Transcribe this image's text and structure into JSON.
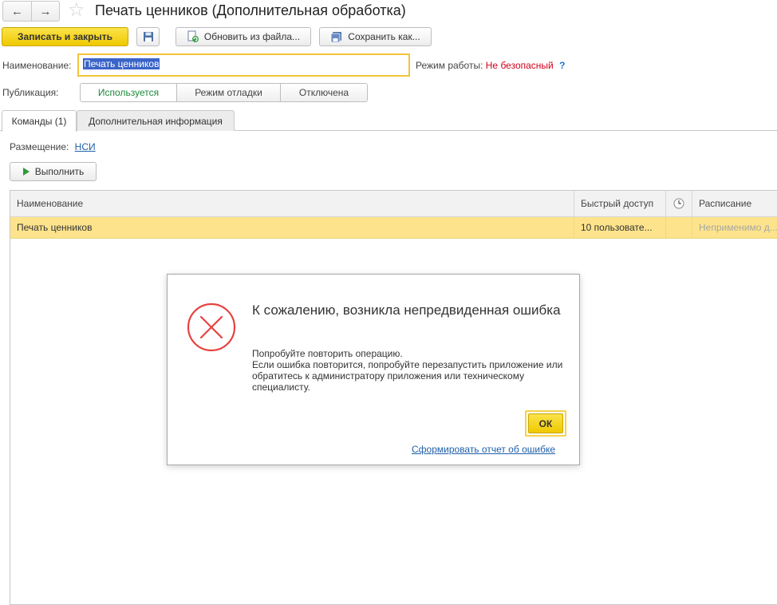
{
  "window": {
    "title": "Печать ценников (Дополнительная обработка)",
    "back_icon": "←",
    "forward_icon": "→",
    "star_icon": "☆"
  },
  "toolbar": {
    "save_close_label": "Записать и закрыть",
    "update_from_file_label": "Обновить из файла...",
    "save_as_label": "Сохранить как..."
  },
  "form": {
    "name_label": "Наименование:",
    "name_value": "Печать ценников",
    "mode_label": "Режим работы:",
    "mode_value": "Не безопасный",
    "help_label": "?",
    "publication_label": "Публикация:",
    "publication_options": [
      "Используется",
      "Режим отладки",
      "Отключена"
    ],
    "publication_selected": "Используется"
  },
  "tabs": [
    {
      "label": "Команды (1)",
      "active": true
    },
    {
      "label": "Дополнительная информация",
      "active": false
    }
  ],
  "commands": {
    "placement_label": "Размещение:",
    "placement_value": "НСИ",
    "run_label": "Выполнить",
    "columns": [
      "Наименование",
      "Быстрый доступ",
      "",
      "Расписание"
    ],
    "rows": [
      {
        "name": "Печать ценников",
        "quick_access": "10 пользовате...",
        "clock": "",
        "schedule": "Неприменимо д..."
      }
    ]
  },
  "dialog": {
    "title": "К сожалению, возникла непредвиденная ошибка",
    "line1": "Попробуйте повторить операцию.",
    "line2": "Если ошибка повторится, попробуйте перезапустить приложение или обратитесь к администратору приложения или техническому специалисту.",
    "ok_label": "ОК",
    "report_link": "Сформировать отчет об ошибке"
  },
  "colors": {
    "accent_yellow": "#f5d000",
    "error_red": "#e8423f",
    "link_blue": "#1f5fa8",
    "selected_row": "#fde48c"
  }
}
